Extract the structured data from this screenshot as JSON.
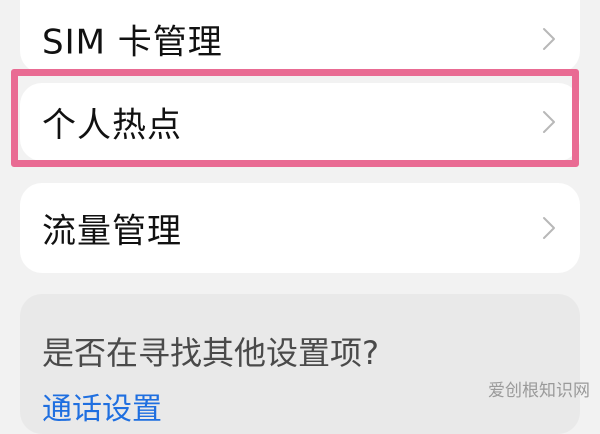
{
  "menu": {
    "sim_label": "SIM 卡管理",
    "hotspot_label": "个人热点",
    "data_label": "流量管理"
  },
  "search_suggest": {
    "title": "是否在寻找其他设置项?",
    "link": "通话设置"
  },
  "watermark": "爱创根知识网",
  "colors": {
    "highlight": "#e96b93",
    "link": "#1f6fe0",
    "background": "#f2f2f2"
  }
}
